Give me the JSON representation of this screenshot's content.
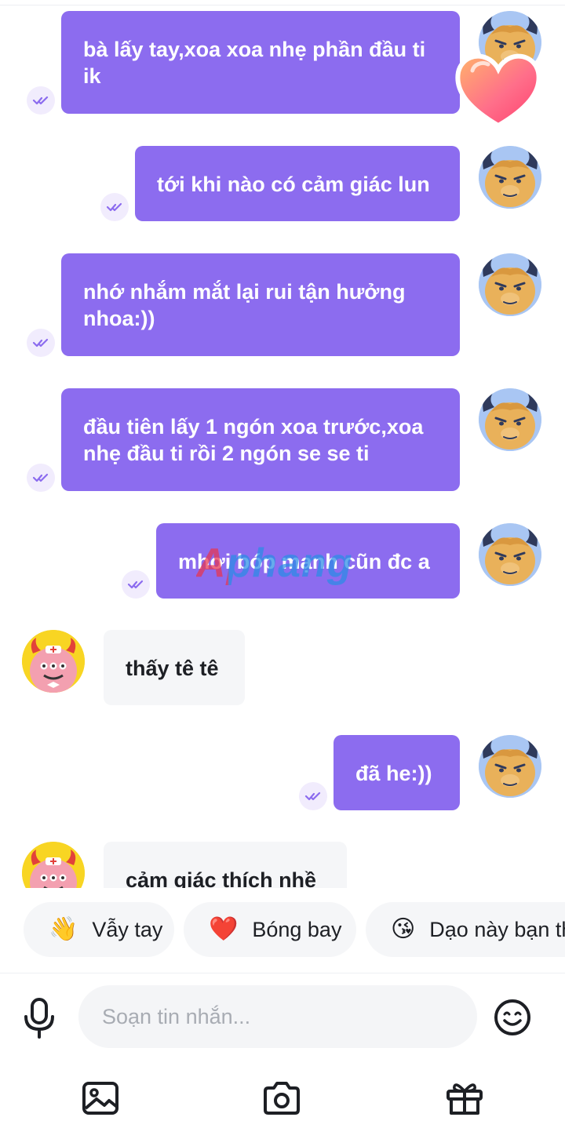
{
  "messages": [
    {
      "side": "out",
      "text_line1": "bà lấy tay,xoa xoa nhẹ phần đầu ti",
      "text_line2": "ik"
    },
    {
      "side": "out",
      "text_line1": "tới khi nào có cảm giác lun"
    },
    {
      "side": "out",
      "text_line1": "nhớ nhắm mắt lại rui tận hưởng",
      "text_line2": "nhoa:))"
    },
    {
      "side": "out",
      "text_line1": "đầu tiên lấy 1 ngón xoa trước,xoa",
      "text_line2": "nhẹ đầu ti rồi 2 ngón se se ti"
    },
    {
      "side": "out",
      "text_line1": "mhơi bóp mạnh cũn đc a"
    },
    {
      "side": "in",
      "text_line1": "thấy tê tê"
    },
    {
      "side": "out",
      "text_line1": "đã he:))"
    },
    {
      "side": "in",
      "text_line1": "cảm giác thích nhề"
    }
  ],
  "watermark": "Aphang",
  "quick_replies": [
    {
      "emoji": "👋",
      "label": "Vẫy tay"
    },
    {
      "emoji": "❤️",
      "label": "Bóng bay"
    },
    {
      "emoji": "😘",
      "label": "Dạo này bạn th"
    }
  ],
  "composer": {
    "placeholder": "Soạn tin nhắn..."
  },
  "colors": {
    "outgoing_bubble": "#8c6cef",
    "incoming_bubble": "#f5f6f8",
    "read_tick": "#8c6cef"
  },
  "icons": [
    "mic-icon",
    "emoji-icon",
    "image-icon",
    "camera-icon",
    "gift-icon",
    "read-receipt-icon",
    "heart-sticker"
  ]
}
